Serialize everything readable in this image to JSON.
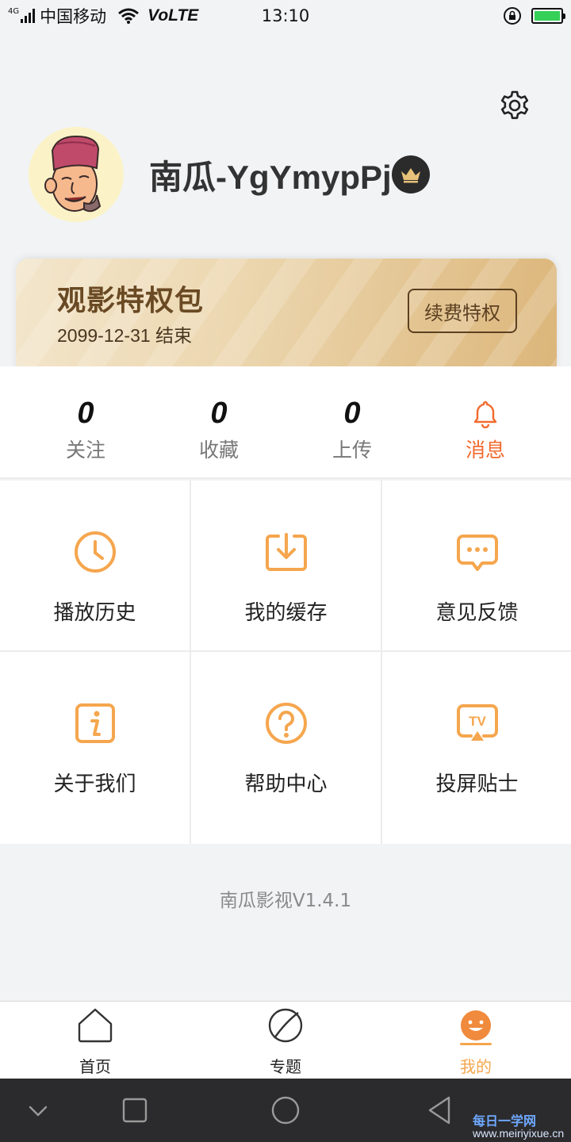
{
  "status_bar": {
    "network": "4G",
    "carrier": "中国移动",
    "volte": "VoLTE",
    "time": "13:10",
    "battery_level": 1.0
  },
  "profile": {
    "username": "南瓜-YgYmypPj",
    "settings_icon": "gear-icon",
    "badge_icon": "crown-icon"
  },
  "vip_card": {
    "title": "观影特权包",
    "expire_text": "2099-12-31 结束",
    "renew_label": "续费特权"
  },
  "stats": [
    {
      "count": "0",
      "label": "关注"
    },
    {
      "count": "0",
      "label": "收藏"
    },
    {
      "count": "0",
      "label": "上传"
    },
    {
      "label": "消息",
      "icon": "bell-icon"
    }
  ],
  "menu": [
    {
      "label": "播放历史",
      "icon": "clock-icon"
    },
    {
      "label": "我的缓存",
      "icon": "download-icon"
    },
    {
      "label": "意见反馈",
      "icon": "chat-bubble-icon"
    },
    {
      "label": "关于我们",
      "icon": "info-icon"
    },
    {
      "label": "帮助中心",
      "icon": "question-icon"
    },
    {
      "label": "投屏贴士",
      "icon": "tv-cast-icon"
    }
  ],
  "app_version": "南瓜影视V1.4.1",
  "tabs": [
    {
      "label": "首页",
      "icon": "home-icon"
    },
    {
      "label": "专题",
      "icon": "planet-icon"
    },
    {
      "label": "我的",
      "icon": "smiley-icon",
      "active": true
    }
  ],
  "watermark": {
    "title": "每日一学网",
    "url": "www.meiriyixue.cn"
  },
  "colors": {
    "accent": "#f5a64e",
    "message_accent": "#f26a2e",
    "background": "#f1f3f5"
  }
}
